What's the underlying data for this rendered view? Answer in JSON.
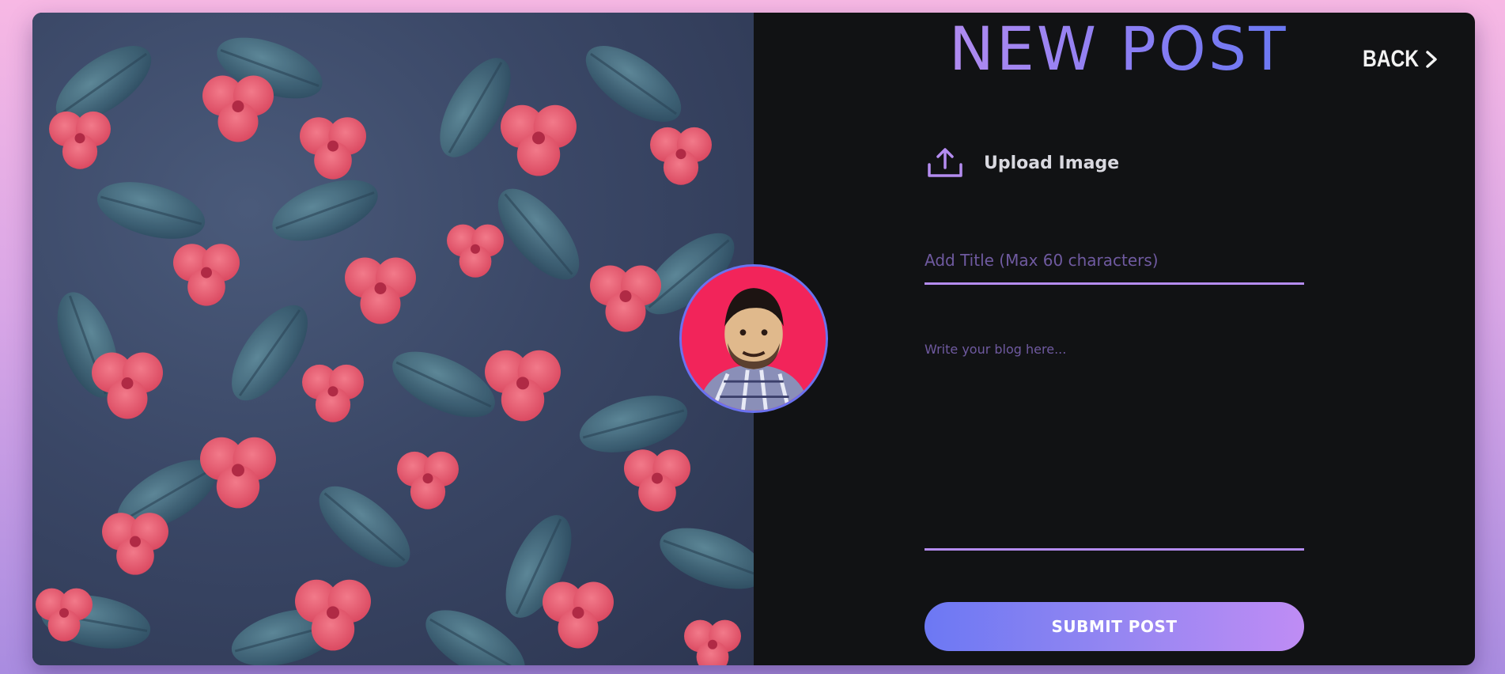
{
  "header": {
    "title": "NEW POST",
    "back_label": "BACK",
    "back_icon": "chevron-right-icon"
  },
  "upload": {
    "label": "Upload Image",
    "icon": "upload-icon"
  },
  "form": {
    "title_placeholder": "Add Title (Max 60 characters)",
    "title_value": "",
    "body_placeholder": "Write your blog here...",
    "body_value": "",
    "submit_label": "SUBMIT POST"
  },
  "colors": {
    "accent_start": "#6c78f3",
    "accent_end": "#bf8cf4",
    "panel_background": "#111214",
    "underline": "#b48cf0",
    "avatar_background": "#f2245a",
    "avatar_border": "#6a72f0"
  }
}
